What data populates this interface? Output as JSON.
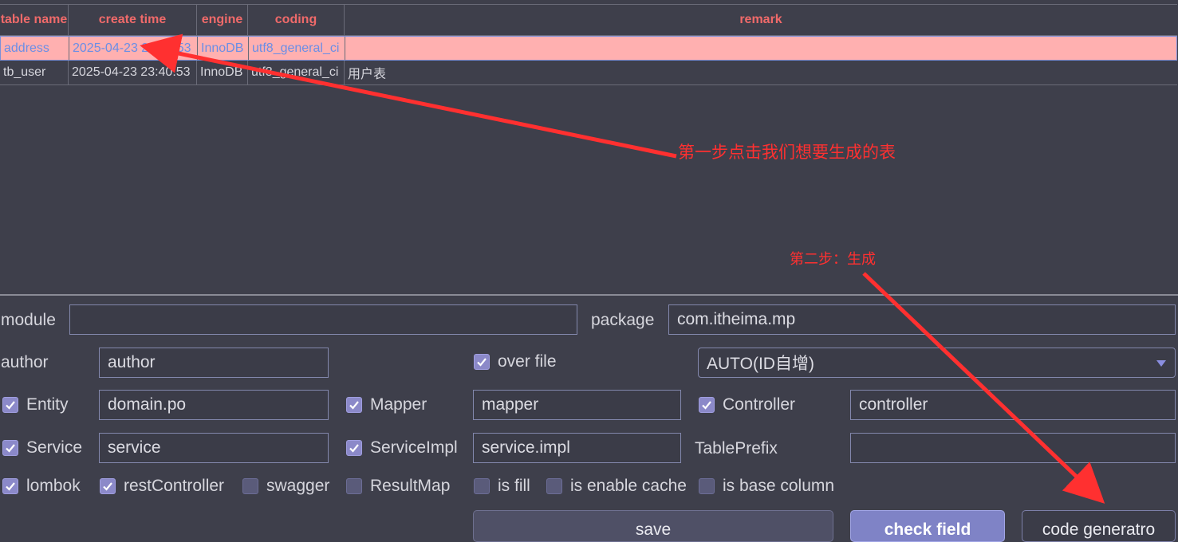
{
  "table": {
    "headers": [
      "table name",
      "create time",
      "engine",
      "coding",
      "remark"
    ],
    "rows": [
      [
        "address",
        "2025-04-23 23:40:53",
        "InnoDB",
        "utf8_general_ci",
        ""
      ],
      [
        "tb_user",
        "2025-04-23 23:40:53",
        "InnoDB",
        "utf8_general_ci",
        "用户表"
      ]
    ]
  },
  "form": {
    "module_label": "module",
    "module_value": "",
    "package_label": "package",
    "package_value": "com.itheima.mp",
    "author_label": "author",
    "author_value": "author",
    "over_file": {
      "label": "over file",
      "checked": true
    },
    "id_type": "AUTO(ID自增)",
    "entity": {
      "label": "Entity",
      "checked": true,
      "value": "domain.po"
    },
    "mapper": {
      "label": "Mapper",
      "checked": true,
      "value": "mapper"
    },
    "controller": {
      "label": "Controller",
      "checked": true,
      "value": "controller"
    },
    "service": {
      "label": "Service",
      "checked": true,
      "value": "service"
    },
    "service_impl": {
      "label": "ServiceImpl",
      "checked": true,
      "value": "service.impl"
    },
    "table_prefix_label": "TablePrefix",
    "table_prefix_value": "",
    "options": {
      "lombok": {
        "label": "lombok",
        "checked": true
      },
      "rest_controller": {
        "label": "restController",
        "checked": true
      },
      "swagger": {
        "label": "swagger",
        "checked": false
      },
      "result_map": {
        "label": "ResultMap",
        "checked": false
      },
      "is_fill": {
        "label": "is fill",
        "checked": false
      },
      "is_enable_cache": {
        "label": "is enable cache",
        "checked": false
      },
      "is_base_column": {
        "label": "is base column",
        "checked": false
      }
    },
    "buttons": {
      "save": "save",
      "check_field": "check field",
      "code_generatro": "code generatro"
    }
  },
  "annotations": {
    "step1": "第一步点击我们想要生成的表",
    "step2": "第二步：生成"
  },
  "colors": {
    "background": "#3e3f4b",
    "header_text": "#f06a6a",
    "selected_row": "#ffb0b0",
    "selected_text": "#6b8ee6",
    "annotation": "#ff3030",
    "checkbox_on": "#8b89c9"
  }
}
